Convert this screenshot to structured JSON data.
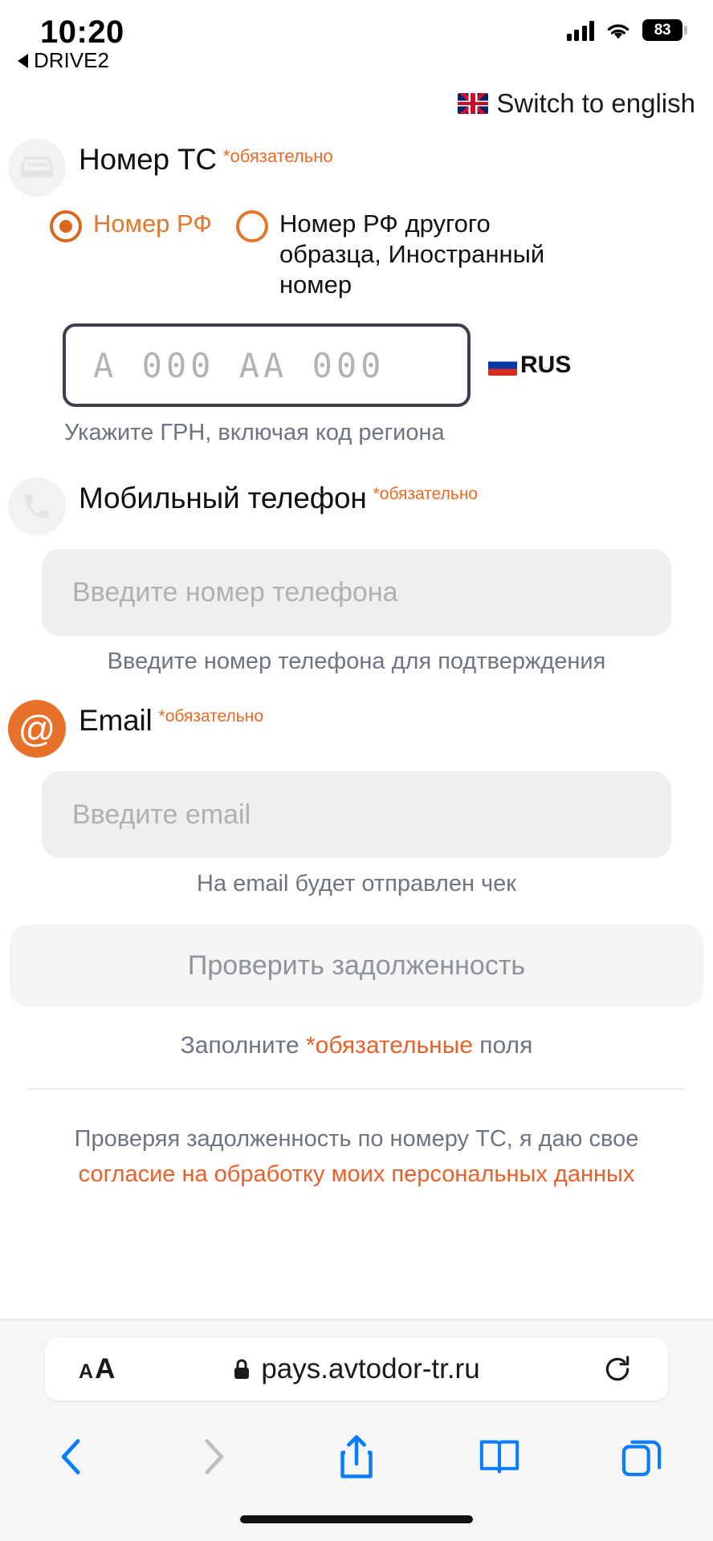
{
  "status_bar": {
    "time": "10:20",
    "back_app": "DRIVE2",
    "battery": "83",
    "signal_icon": "cellular-bars-icon",
    "wifi_icon": "wifi-icon",
    "battery_icon": "battery-icon"
  },
  "language": {
    "flag_icon": "uk-flag-icon",
    "switch_label": "Switch to english"
  },
  "vehicle": {
    "icon": "car-icon",
    "title": "Номер ТС",
    "required_label": "*обязательно",
    "options": [
      {
        "label": "Номер РФ",
        "selected": true
      },
      {
        "label": "Номер РФ другого образца, Иностранный номер",
        "selected": false
      }
    ],
    "plate_placeholder": "А 000 АА 000",
    "country_flag_icon": "russia-flag-icon",
    "country_code": "RUS",
    "hint": "Укажите ГРН, включая код региона"
  },
  "phone": {
    "icon": "phone-icon",
    "title": "Мобильный телефон",
    "required_label": "*обязательно",
    "placeholder": "Введите номер телефона",
    "value": "",
    "hint": "Введите номер телефона для подтверждения"
  },
  "email": {
    "icon": "at-icon",
    "title": "Email",
    "required_label": "*обязательно",
    "placeholder": "Введите email",
    "value": "",
    "hint": "На email будет отправлен чек"
  },
  "submit": {
    "label": "Проверить задолженность",
    "enabled": false
  },
  "fill_note": {
    "prefix": "Заполните ",
    "accent": "*обязательные",
    "suffix": " поля"
  },
  "consent": {
    "text": "Проверяя задолженность по номеру ТС, я даю свое",
    "link": "согласие на обработку моих персональных данных"
  },
  "browser": {
    "text_size_small": "A",
    "text_size_large": "A",
    "lock_icon": "lock-icon",
    "url": "pays.avtodor-tr.ru",
    "reload_icon": "reload-icon",
    "back_icon": "chevron-left-icon",
    "forward_icon": "chevron-right-icon",
    "share_icon": "share-icon",
    "bookmarks_icon": "book-icon",
    "tabs_icon": "tabs-icon"
  },
  "colors": {
    "accent": "#e8612a",
    "muted": "#6e7480",
    "field_bg": "#efeff0"
  }
}
